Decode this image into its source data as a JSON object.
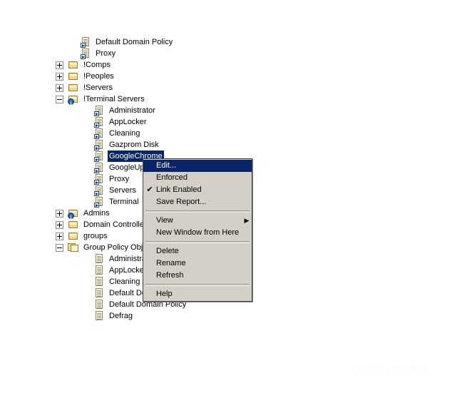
{
  "tree": {
    "items": [
      {
        "label": "Default Domain Policy",
        "icon": "gpo-link-icon",
        "indent": 1,
        "expander": "none",
        "selected": false
      },
      {
        "label": "Proxy",
        "icon": "gpo-link-icon",
        "indent": 1,
        "expander": "none",
        "selected": false
      },
      {
        "label": "!Comps",
        "icon": "ou-folder-icon",
        "indent": 0,
        "expander": "collapsed",
        "selected": false
      },
      {
        "label": "!Peoples",
        "icon": "ou-folder-icon",
        "indent": 0,
        "expander": "collapsed",
        "selected": false
      },
      {
        "label": "!Servers",
        "icon": "ou-folder-icon",
        "indent": 0,
        "expander": "collapsed",
        "selected": false
      },
      {
        "label": "!Terminal Servers",
        "icon": "ou-folder-warning-icon",
        "indent": 0,
        "expander": "expanded",
        "selected": false
      },
      {
        "label": "Administrator",
        "icon": "gpo-link-icon",
        "indent": 2,
        "expander": "none",
        "selected": false
      },
      {
        "label": "AppLocker",
        "icon": "gpo-link-icon",
        "indent": 2,
        "expander": "none",
        "selected": false
      },
      {
        "label": "Cleaning",
        "icon": "gpo-link-icon",
        "indent": 2,
        "expander": "none",
        "selected": false
      },
      {
        "label": "Gazprom Disk",
        "icon": "gpo-link-icon",
        "indent": 2,
        "expander": "none",
        "selected": false
      },
      {
        "label": "GoogleChrome",
        "icon": "gpo-link-icon",
        "indent": 2,
        "expander": "none",
        "selected": true
      },
      {
        "label": "GoogleUpdate",
        "icon": "gpo-link-icon",
        "indent": 2,
        "expander": "none",
        "selected": false
      },
      {
        "label": "Proxy",
        "icon": "gpo-link-icon",
        "indent": 2,
        "expander": "none",
        "selected": false
      },
      {
        "label": "Servers",
        "icon": "gpo-link-icon",
        "indent": 2,
        "expander": "none",
        "selected": false
      },
      {
        "label": "Terminal",
        "icon": "gpo-link-icon",
        "indent": 2,
        "expander": "none",
        "selected": false
      },
      {
        "label": "Admins",
        "icon": "ou-folder-warning-icon",
        "indent": 0,
        "expander": "collapsed",
        "selected": false
      },
      {
        "label": "Domain Controllers",
        "icon": "ou-folder-icon",
        "indent": 0,
        "expander": "collapsed",
        "selected": false
      },
      {
        "label": "groups",
        "icon": "ou-folder-icon",
        "indent": 0,
        "expander": "collapsed",
        "selected": false
      },
      {
        "label": "Group Policy Objects",
        "icon": "gpo-container-icon",
        "indent": 0,
        "expander": "expanded",
        "selected": false
      },
      {
        "label": "Administrator",
        "icon": "gpo-icon",
        "indent": 2,
        "expander": "none",
        "selected": false
      },
      {
        "label": "AppLocker",
        "icon": "gpo-icon",
        "indent": 2,
        "expander": "none",
        "selected": false
      },
      {
        "label": "Cleaning",
        "icon": "gpo-icon",
        "indent": 2,
        "expander": "none",
        "selected": false
      },
      {
        "label": "Default Domain Controllers Policy",
        "icon": "gpo-icon",
        "indent": 2,
        "expander": "none",
        "selected": false
      },
      {
        "label": "Default Domain Policy",
        "icon": "gpo-icon",
        "indent": 2,
        "expander": "none",
        "selected": false
      },
      {
        "label": "Defrag",
        "icon": "gpo-icon",
        "indent": 2,
        "expander": "none",
        "selected": false
      }
    ]
  },
  "context_menu": {
    "items": [
      {
        "type": "item",
        "label": "Edit...",
        "checked": false,
        "submenu": false,
        "highlight": true
      },
      {
        "type": "item",
        "label": "Enforced",
        "checked": false,
        "submenu": false,
        "highlight": false
      },
      {
        "type": "item",
        "label": "Link Enabled",
        "checked": true,
        "submenu": false,
        "highlight": false
      },
      {
        "type": "item",
        "label": "Save Report...",
        "checked": false,
        "submenu": false,
        "highlight": false
      },
      {
        "type": "separator"
      },
      {
        "type": "item",
        "label": "View",
        "checked": false,
        "submenu": true,
        "highlight": false
      },
      {
        "type": "item",
        "label": "New Window from Here",
        "checked": false,
        "submenu": false,
        "highlight": false
      },
      {
        "type": "separator"
      },
      {
        "type": "item",
        "label": "Delete",
        "checked": false,
        "submenu": false,
        "highlight": false
      },
      {
        "type": "item",
        "label": "Rename",
        "checked": false,
        "submenu": false,
        "highlight": false
      },
      {
        "type": "item",
        "label": "Refresh",
        "checked": false,
        "submenu": false,
        "highlight": false
      },
      {
        "type": "separator"
      },
      {
        "type": "item",
        "label": "Help",
        "checked": false,
        "submenu": false,
        "highlight": false
      }
    ],
    "check_glyph": "✔",
    "submenu_glyph": "▶"
  },
  "watermark": {
    "text": "remontka"
  },
  "colors": {
    "selection": "#0a246a",
    "menu_background": "#d4d0c8",
    "menu_border": "#404040",
    "folder_fill": "#f3d98b",
    "page_fill": "#fdfbe8"
  }
}
